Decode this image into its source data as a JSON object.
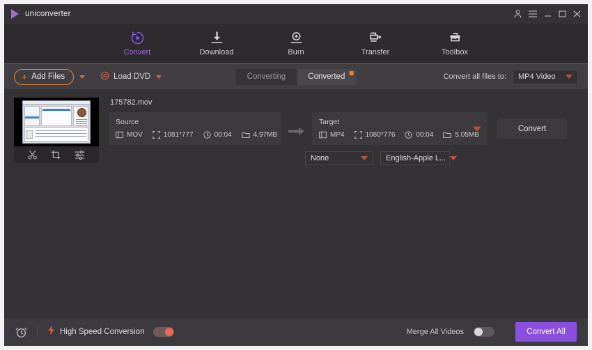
{
  "titlebar": {
    "app_name": "uniconverter",
    "logo": "play-triangle-logo",
    "controls": [
      {
        "name": "account-icon",
        "glyph": "account"
      },
      {
        "name": "menu-icon",
        "glyph": "hamburger"
      },
      {
        "name": "minimize-button",
        "glyph": "minimize"
      },
      {
        "name": "maximize-button",
        "glyph": "maximize"
      },
      {
        "name": "close-button",
        "glyph": "close"
      }
    ]
  },
  "nav": {
    "active": "Convert",
    "items": [
      {
        "label": "Convert",
        "icon": "convert-circle-icon"
      },
      {
        "label": "Download",
        "icon": "download-arrow-icon"
      },
      {
        "label": "Burn",
        "icon": "burn-disc-icon"
      },
      {
        "label": "Transfer",
        "icon": "transfer-device-icon"
      },
      {
        "label": "Toolbox",
        "icon": "toolbox-icon"
      }
    ]
  },
  "toolbar": {
    "add_files_label": "Add Files",
    "load_dvd_label": "Load DVD",
    "tabs": [
      {
        "label": "Converting",
        "active": false,
        "badge": false
      },
      {
        "label": "Converted",
        "active": true,
        "badge": true
      }
    ],
    "convert_all_to_label": "Convert all files to:",
    "convert_all_to_value": "MP4 Video"
  },
  "file": {
    "name": "175782.mov",
    "source": {
      "title": "Source",
      "format": "MOV",
      "resolution": "1081*777",
      "duration": "00:04",
      "size": "4.97MB"
    },
    "target": {
      "title": "Target",
      "format": "MP4",
      "resolution": "1080*776",
      "duration": "00:04",
      "size": "5.05MB"
    },
    "subtitle_value": "None",
    "audio_value": "English-Apple L...",
    "convert_button": "Convert",
    "tools": [
      {
        "name": "trim-icon"
      },
      {
        "name": "crop-icon"
      },
      {
        "name": "effects-icon"
      }
    ]
  },
  "bottombar": {
    "alarm_icon": "alarm-clock-icon",
    "high_speed_label": "High Speed Conversion",
    "high_speed_on": true,
    "merge_label": "Merge All Videos",
    "merge_on": false,
    "convert_all_label": "Convert All"
  },
  "colors": {
    "accent_purple": "#8b4fe0",
    "accent_orange": "#e8833a",
    "toggle_on": "#ec6a52",
    "window_bg": "#2e2b2e",
    "content_bg": "#353236",
    "panel_bg": "#3d3a3f"
  }
}
